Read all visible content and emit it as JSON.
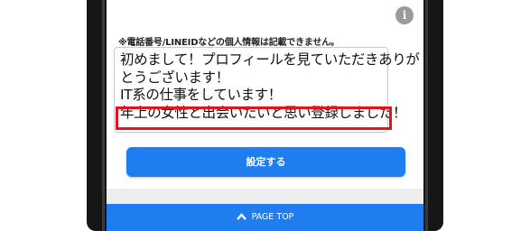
{
  "profile": {
    "notice": "※電話番号/LINEIDなどの個人情報は記載できません。",
    "message_lines": [
      "初めまして！プロフィールを見ていただきありが",
      "とうございます！",
      "IT系の仕事をしています！",
      "年上の女性と出会いたいと思い登録しました！"
    ]
  },
  "info_icon": {
    "icon": "info-icon",
    "glyph": "i"
  },
  "submit": {
    "label": "設定する"
  },
  "footer": {
    "page_top_label": "PAGE TOP",
    "icon": "chevron-up-icon"
  },
  "colors": {
    "accent": "#1e7ef0",
    "highlight": "#e5141a",
    "frame": "#161616"
  }
}
